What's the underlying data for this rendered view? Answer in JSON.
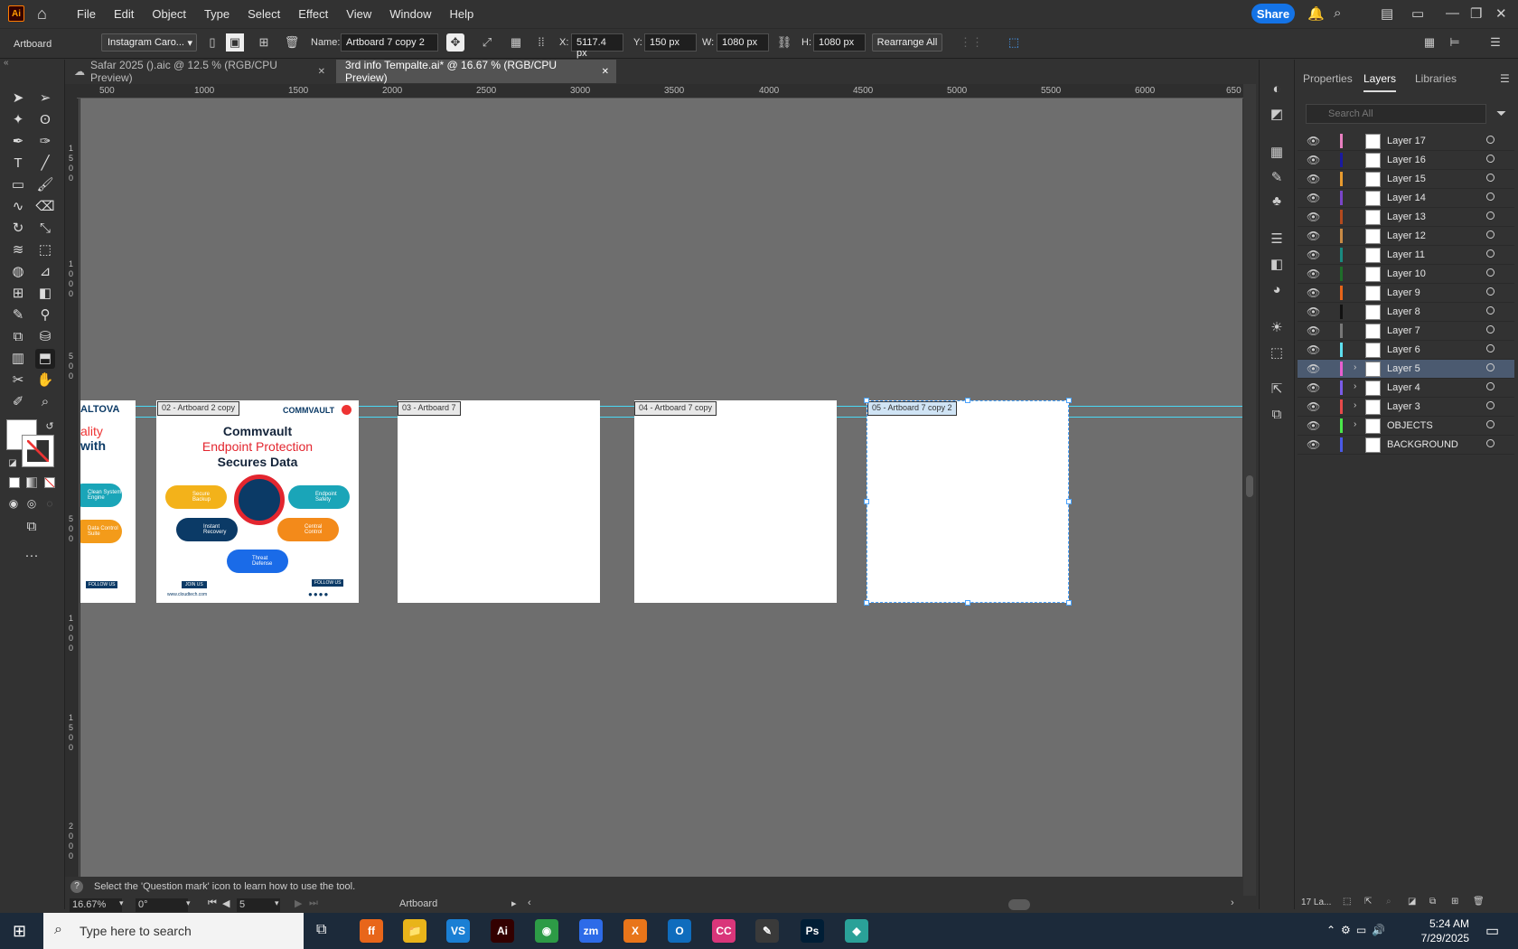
{
  "app": {
    "logo": "Ai"
  },
  "menu": [
    "File",
    "Edit",
    "Object",
    "Type",
    "Select",
    "Effect",
    "View",
    "Window",
    "Help"
  ],
  "share_label": "Share",
  "control": {
    "mode": "Artboard",
    "preset": "Instagram Caro...",
    "name_label": "Name:",
    "name_value": "Artboard 7 copy 2",
    "x_label": "X:",
    "x_value": "5117.4 px",
    "y_label": "Y:",
    "y_value": "150 px",
    "w_label": "W:",
    "w_value": "1080 px",
    "h_label": "H:",
    "h_value": "1080 px",
    "rearrange": "Rearrange All"
  },
  "tabs": [
    {
      "label": "Safar 2025 ().aic @ 12.5 % (RGB/CPU Preview)",
      "close": "✕"
    },
    {
      "label": "3rd info Tempalte.ai* @ 16.67 % (RGB/CPU Preview)",
      "close": "✕"
    }
  ],
  "ruler_h": [
    "500",
    "1000",
    "1500",
    "2000",
    "2500",
    "3000",
    "3500",
    "4000",
    "4500",
    "5000",
    "5500",
    "6000",
    "650"
  ],
  "artboards": [
    {
      "label": "02 - Artboard 2 copy"
    },
    {
      "label": "03 - Artboard 7"
    },
    {
      "label": "04 - Artboard 7 copy"
    },
    {
      "label": "05 - Artboard 7 copy 2"
    }
  ],
  "art_partial": {
    "brand": "ALTOVA",
    "line1": "ality",
    "line2": "with",
    "pill1": "Clean System Engine",
    "pill2": "Data Control Suite",
    "follow": "FOLLOW US"
  },
  "art_main": {
    "brand": "COMMVAULT",
    "title1": "Commvault",
    "title2": "Endpoint Protection",
    "title3": "Secures Data",
    "pills": [
      "Secure Backup",
      "Endpoint Safety",
      "Instant Recovery",
      "Central Control",
      "Threat Defense"
    ],
    "join": "JOIN US",
    "follow": "FOLLOW US",
    "url": "www.cloudtech.com"
  },
  "status_text": "Select the 'Question mark' icon to learn how to use the tool.",
  "bottom": {
    "zoom": "16.67%",
    "angle": "0°",
    "artboard_num": "5",
    "mode": "Artboard"
  },
  "panel": {
    "tabs": [
      "Properties",
      "Layers",
      "Libraries"
    ],
    "search_placeholder": "Search All",
    "footer": "17 La...",
    "layers": [
      {
        "name": "Layer 17",
        "color": "#e87fc0",
        "selected": false,
        "expandable": false
      },
      {
        "name": "Layer 16",
        "color": "#1a1aa0",
        "selected": false,
        "expandable": false
      },
      {
        "name": "Layer 15",
        "color": "#e89b2f",
        "selected": false,
        "expandable": false
      },
      {
        "name": "Layer 14",
        "color": "#7a45c9",
        "selected": false,
        "expandable": false
      },
      {
        "name": "Layer 13",
        "color": "#b34a1e",
        "selected": false,
        "expandable": false
      },
      {
        "name": "Layer 12",
        "color": "#c98a45",
        "selected": false,
        "expandable": false
      },
      {
        "name": "Layer 11",
        "color": "#1a8a80",
        "selected": false,
        "expandable": false
      },
      {
        "name": "Layer 10",
        "color": "#1f6e2a",
        "selected": false,
        "expandable": false
      },
      {
        "name": "Layer 9",
        "color": "#e8651a",
        "selected": false,
        "expandable": false
      },
      {
        "name": "Layer 8",
        "color": "#111111",
        "selected": false,
        "expandable": false
      },
      {
        "name": "Layer 7",
        "color": "#777777",
        "selected": false,
        "expandable": false
      },
      {
        "name": "Layer 6",
        "color": "#5ee0f0",
        "selected": false,
        "expandable": false
      },
      {
        "name": "Layer 5",
        "color": "#e85fd0",
        "selected": true,
        "expandable": true
      },
      {
        "name": "Layer 4",
        "color": "#7a5ce8",
        "selected": false,
        "expandable": true
      },
      {
        "name": "Layer 3",
        "color": "#e84a4a",
        "selected": false,
        "expandable": true
      },
      {
        "name": "OBJECTS",
        "color": "#4ae84a",
        "selected": false,
        "expandable": true
      },
      {
        "name": "BACKGROUND",
        "color": "#4a5ae8",
        "selected": false,
        "expandable": false
      }
    ]
  },
  "taskbar": {
    "search": "Type here to search",
    "time": "5:24 AM",
    "date": "7/29/2025",
    "apps": [
      {
        "label": "ff",
        "color": "#e8661a"
      },
      {
        "label": "📁",
        "color": "#e8b41a"
      },
      {
        "label": "VS",
        "color": "#1a7fd4"
      },
      {
        "label": "Ai",
        "color": "#330000"
      },
      {
        "label": "◉",
        "color": "#2d9b46"
      },
      {
        "label": "zm",
        "color": "#2d6be8"
      },
      {
        "label": "X",
        "color": "#e8751a"
      },
      {
        "label": "O",
        "color": "#0f6cbd"
      },
      {
        "label": "CC",
        "color": "#d9367a"
      },
      {
        "label": "✎",
        "color": "#3a3a3a"
      },
      {
        "label": "Ps",
        "color": "#001e36"
      },
      {
        "label": "◆",
        "color": "#2aa198"
      }
    ]
  }
}
